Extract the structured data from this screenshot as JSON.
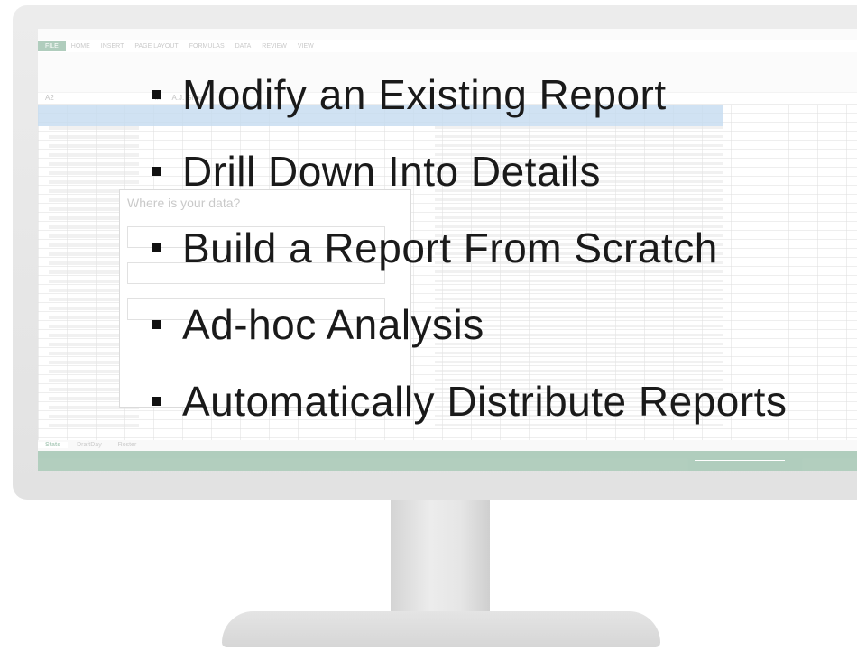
{
  "excel": {
    "ribbon_tabs": [
      "FILE",
      "HOME",
      "INSERT",
      "PAGE LAYOUT",
      "FORMULAS",
      "DATA",
      "REVIEW",
      "VIEW"
    ],
    "cell_ref": "A2",
    "formula_value": "A.J. Green",
    "dialog_title": "Where is your data?",
    "sheet_tabs": [
      "Stats",
      "DraftDay",
      "Roster"
    ]
  },
  "bullets": [
    "Modify an Existing Report",
    "Drill Down Into Details",
    "Build a Report From Scratch",
    "Ad-hoc Analysis",
    "Automatically Distribute Reports"
  ],
  "colors": {
    "excel_green": "#217346",
    "header_blue": "#5b9bd5",
    "text": "#1a1a1a"
  }
}
